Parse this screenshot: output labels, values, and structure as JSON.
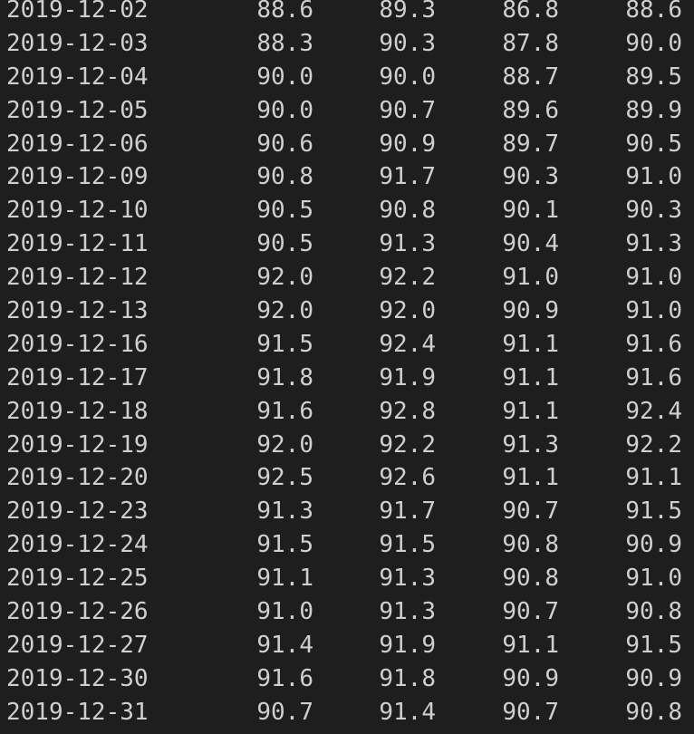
{
  "terminal": {
    "rows": [
      {
        "date": "2019-12-02",
        "v1": "88.6",
        "v2": "89.3",
        "v3": "86.8",
        "v4": "88.6"
      },
      {
        "date": "2019-12-03",
        "v1": "88.3",
        "v2": "90.3",
        "v3": "87.8",
        "v4": "90.0"
      },
      {
        "date": "2019-12-04",
        "v1": "90.0",
        "v2": "90.0",
        "v3": "88.7",
        "v4": "89.5"
      },
      {
        "date": "2019-12-05",
        "v1": "90.0",
        "v2": "90.7",
        "v3": "89.6",
        "v4": "89.9"
      },
      {
        "date": "2019-12-06",
        "v1": "90.6",
        "v2": "90.9",
        "v3": "89.7",
        "v4": "90.5"
      },
      {
        "date": "2019-12-09",
        "v1": "90.8",
        "v2": "91.7",
        "v3": "90.3",
        "v4": "91.0"
      },
      {
        "date": "2019-12-10",
        "v1": "90.5",
        "v2": "90.8",
        "v3": "90.1",
        "v4": "90.3"
      },
      {
        "date": "2019-12-11",
        "v1": "90.5",
        "v2": "91.3",
        "v3": "90.4",
        "v4": "91.3"
      },
      {
        "date": "2019-12-12",
        "v1": "92.0",
        "v2": "92.2",
        "v3": "91.0",
        "v4": "91.0"
      },
      {
        "date": "2019-12-13",
        "v1": "92.0",
        "v2": "92.0",
        "v3": "90.9",
        "v4": "91.0"
      },
      {
        "date": "2019-12-16",
        "v1": "91.5",
        "v2": "92.4",
        "v3": "91.1",
        "v4": "91.6"
      },
      {
        "date": "2019-12-17",
        "v1": "91.8",
        "v2": "91.9",
        "v3": "91.1",
        "v4": "91.6"
      },
      {
        "date": "2019-12-18",
        "v1": "91.6",
        "v2": "92.8",
        "v3": "91.1",
        "v4": "92.4"
      },
      {
        "date": "2019-12-19",
        "v1": "92.0",
        "v2": "92.2",
        "v3": "91.3",
        "v4": "92.2"
      },
      {
        "date": "2019-12-20",
        "v1": "92.5",
        "v2": "92.6",
        "v3": "91.1",
        "v4": "91.1"
      },
      {
        "date": "2019-12-23",
        "v1": "91.3",
        "v2": "91.7",
        "v3": "90.7",
        "v4": "91.5"
      },
      {
        "date": "2019-12-24",
        "v1": "91.5",
        "v2": "91.5",
        "v3": "90.8",
        "v4": "90.9"
      },
      {
        "date": "2019-12-25",
        "v1": "91.1",
        "v2": "91.3",
        "v3": "90.8",
        "v4": "91.0"
      },
      {
        "date": "2019-12-26",
        "v1": "91.0",
        "v2": "91.3",
        "v3": "90.7",
        "v4": "90.8"
      },
      {
        "date": "2019-12-27",
        "v1": "91.4",
        "v2": "91.9",
        "v3": "91.1",
        "v4": "91.5"
      },
      {
        "date": "2019-12-30",
        "v1": "91.6",
        "v2": "91.8",
        "v3": "90.9",
        "v4": "90.9"
      },
      {
        "date": "2019-12-31",
        "v1": "90.7",
        "v2": "91.4",
        "v3": "90.7",
        "v4": "90.8"
      }
    ]
  }
}
